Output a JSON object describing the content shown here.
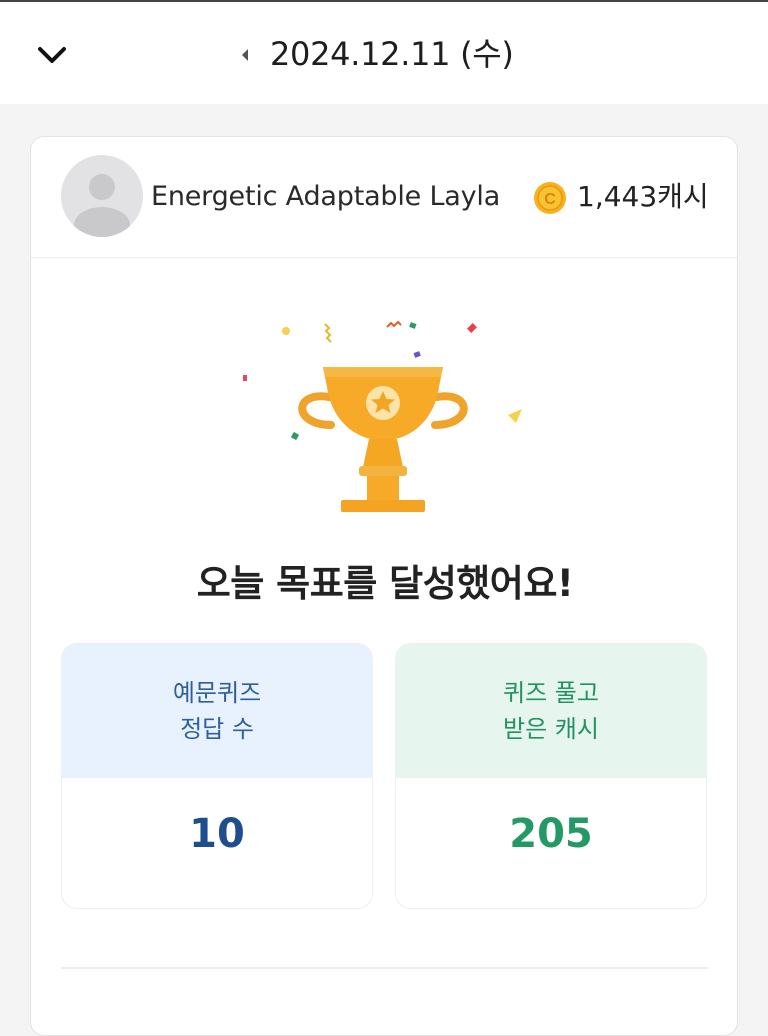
{
  "header": {
    "date": "2024.12.11 (수)"
  },
  "profile": {
    "name": "Energetic Adaptable Layla",
    "cash": "1,443캐시",
    "coin_color": "#f5a623"
  },
  "goal": {
    "message": "오늘 목표를 달성했어요!"
  },
  "stats": [
    {
      "line1": "예문퀴즈",
      "line2": "정답 수",
      "value": "10",
      "color": "#1f4e8f"
    },
    {
      "line1": "퀴즈 풀고",
      "line2": "받은 캐시",
      "value": "205",
      "color": "#239a66"
    }
  ],
  "icons": {
    "back": "chevron-down-icon",
    "prev_date": "caret-left-icon",
    "trophy": "trophy-icon",
    "coin": "coin-icon",
    "avatar": "user-avatar-icon"
  }
}
